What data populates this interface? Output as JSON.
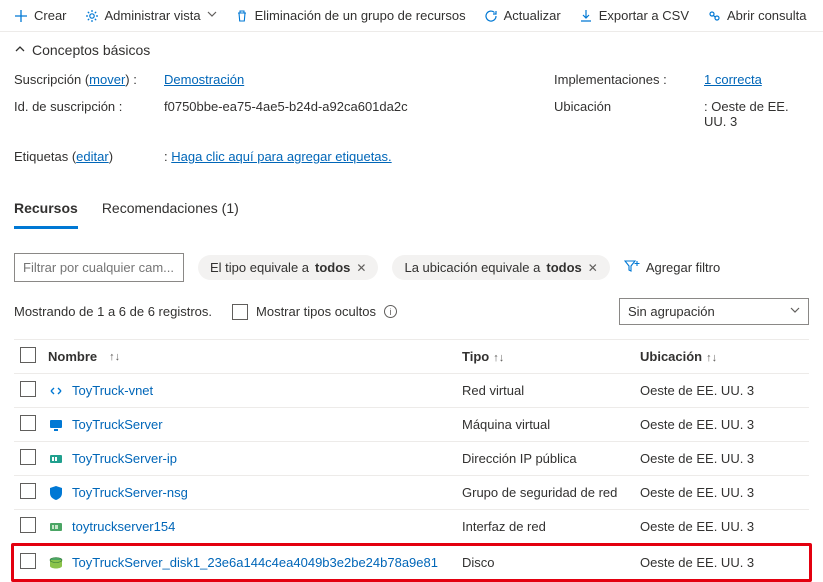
{
  "toolbar": {
    "create": "Crear",
    "manageView": "Administrar vista",
    "delete": "Eliminación de un grupo de recursos",
    "refresh": "Actualizar",
    "export": "Exportar a CSV",
    "openQuery": "Abrir consulta"
  },
  "basics": {
    "header": "Conceptos básicos",
    "subscriptionLabel": "Suscripción",
    "move": "mover",
    "subscriptionValue": "Demostración",
    "subscriptionIdLabel": "Id. de suscripción",
    "subscriptionIdValue": "f0750bbe-ea75-4ae5-b24d-a92ca601da2c",
    "deploymentsLabel": "Implementaciones",
    "deploymentsValue": "1 correcta",
    "locationLabel": "Ubicación",
    "locationValue": "Oeste de EE. UU. 3",
    "tagsLabel": "Etiquetas",
    "tagsEdit": "editar",
    "tagsValue": "Haga clic aquí para agregar etiquetas."
  },
  "tabs": {
    "resources": "Recursos",
    "recommendations": "Recomendaciones (1)"
  },
  "filters": {
    "placeholder": "Filtrar por cualquier cam...",
    "typePrefix": "El tipo equivale a ",
    "typeValue": "todos",
    "locPrefix": "La ubicación equivale a ",
    "locValue": "todos",
    "addFilter": "Agregar filtro"
  },
  "meta": {
    "showing": "Mostrando de 1 a 6 de 6 registros.",
    "hiddenTypes": "Mostrar tipos ocultos",
    "grouping": "Sin agrupación"
  },
  "columns": {
    "name": "Nombre",
    "type": "Tipo",
    "location": "Ubicación"
  },
  "rows": [
    {
      "name": "ToyTruck-vnet",
      "type": "Red virtual",
      "location": "Oeste de EE. UU. 3",
      "icon": "vnet",
      "highlight": false
    },
    {
      "name": "ToyTruckServer",
      "type": "Máquina virtual",
      "location": "Oeste de EE. UU. 3",
      "icon": "vm",
      "highlight": false
    },
    {
      "name": "ToyTruckServer-ip",
      "type": "Dirección IP pública",
      "location": "Oeste de EE. UU. 3",
      "icon": "ip",
      "highlight": false
    },
    {
      "name": "ToyTruckServer-nsg",
      "type": "Grupo de seguridad de red",
      "location": "Oeste de EE. UU. 3",
      "icon": "nsg",
      "highlight": false
    },
    {
      "name": "toytruckserver154",
      "type": "Interfaz de red",
      "location": "Oeste de EE. UU. 3",
      "icon": "nic",
      "highlight": false
    },
    {
      "name": "ToyTruckServer_disk1_23e6a144c4ea4049b3e2be24b78a9e81",
      "type": "Disco",
      "location": "Oeste de EE. UU. 3",
      "icon": "disk",
      "highlight": true
    }
  ]
}
